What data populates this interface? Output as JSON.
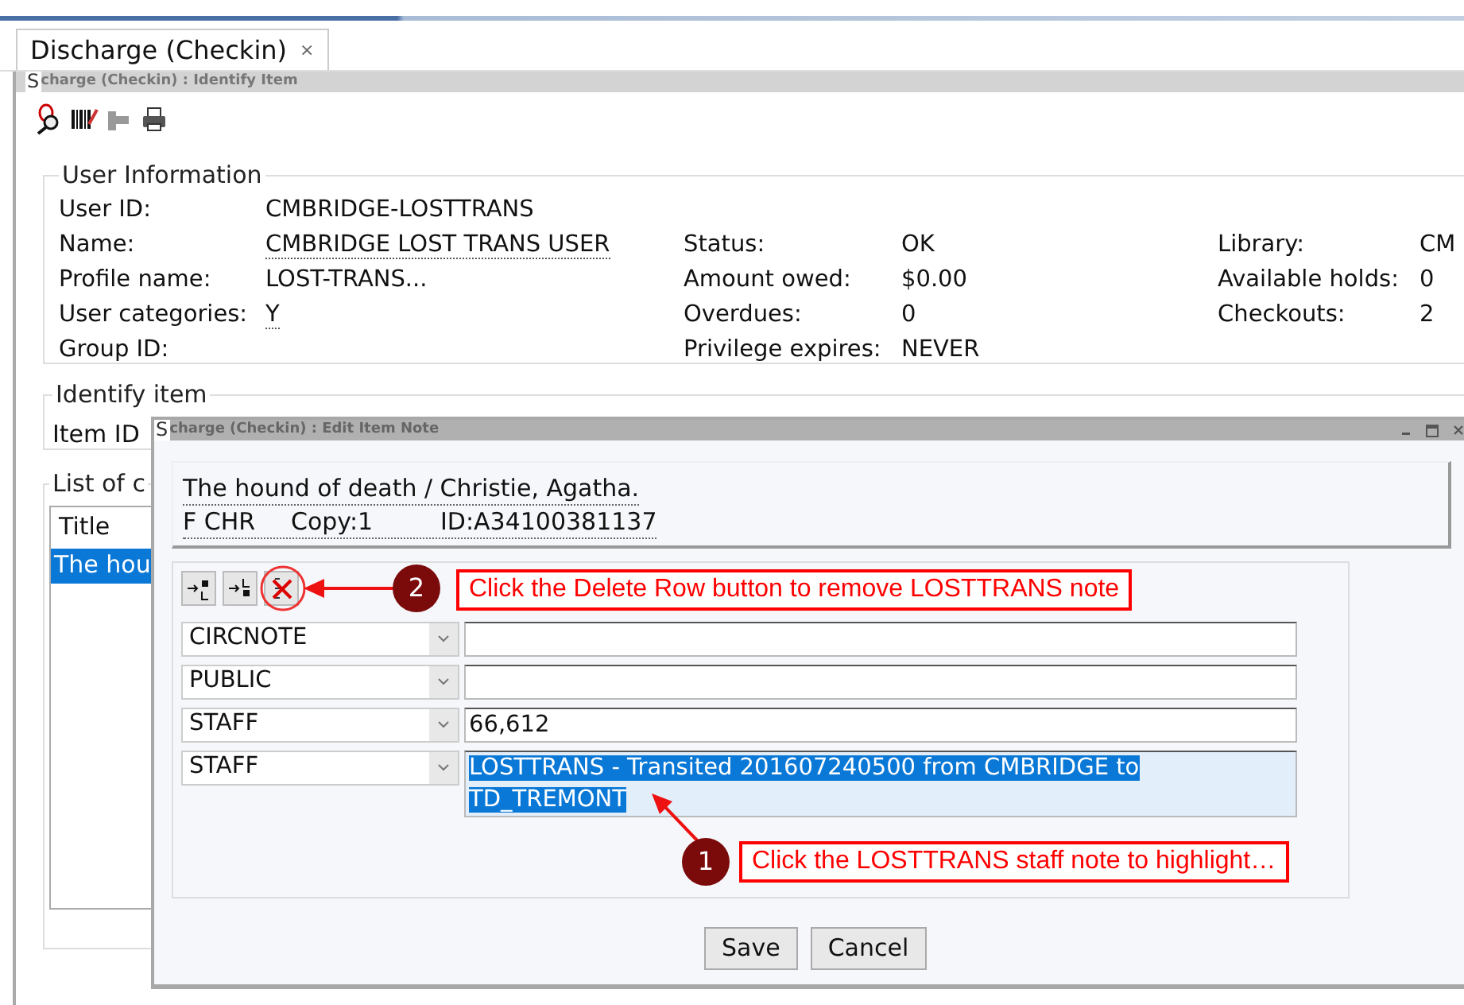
{
  "tab": {
    "label": "Discharge (Checkin)",
    "close": "×",
    "selected": true
  },
  "panel_title": {
    "s_box": "S",
    "text": "charge (Checkin) : Identify Item"
  },
  "user_information": {
    "legend": "User Information",
    "columns": [
      {
        "fields": [
          {
            "label": "User ID:",
            "value": "CMBRIDGE-LOSTTRANS",
            "linked": false
          },
          {
            "label": "Name:",
            "value": "CMBRIDGE LOST TRANS USER",
            "linked": true
          },
          {
            "label": "Profile name:",
            "value": "LOST-TRANS...",
            "linked": false
          },
          {
            "label": "User categories:",
            "value": "Y",
            "linked": true
          },
          {
            "label": "Group ID:"
          }
        ]
      },
      {
        "fields": [
          {
            "label": "Status:",
            "value": "OK",
            "linked": false
          },
          {
            "label": "Amount owed:",
            "value": "$0.00",
            "linked": false
          },
          {
            "label": "Overdues:",
            "value": "0",
            "linked": false
          },
          {
            "label": "Privilege expires:",
            "value": "NEVER",
            "linked": false
          }
        ]
      },
      {
        "fields": [
          {
            "label": "Library:",
            "value": "CM",
            "linked": false
          },
          {
            "label": "Available holds:",
            "value": "0",
            "linked": false
          },
          {
            "label": "Checkouts:",
            "value": "2",
            "linked": false
          }
        ]
      }
    ]
  },
  "identify_item": {
    "legend": "Identify item",
    "label": "Item ID"
  },
  "list": {
    "legend": "List of c",
    "column": "Title",
    "rows": [
      {
        "text": "The hou",
        "selected": true
      }
    ]
  },
  "dialog": {
    "s_box": "S",
    "title": "charge (Checkin) : Edit Item Note",
    "item": {
      "title": "The hound of death / Christie, Agatha.",
      "call_number": "F CHR",
      "copy": "Copy:1",
      "id": "ID:A34100381137"
    },
    "tools": [
      {
        "kind": "insert"
      },
      {
        "kind": "append"
      },
      {
        "kind": "delete"
      }
    ],
    "notes": [
      {
        "type": "CIRCNOTE",
        "selected": false
      },
      {
        "type": "PUBLIC",
        "selected": false
      },
      {
        "type": "STAFF",
        "text": "66,612",
        "selected": false
      },
      {
        "type": "STAFF",
        "text": "LOSTTRANS - Transited 201607240500 from CMBRIDGE to TD_TREMONT",
        "selected": true
      }
    ],
    "buttons": [
      "Save",
      "Cancel"
    ]
  },
  "annotations": [
    {
      "number": "2",
      "text": "Click the Delete Row button to remove LOSTTRANS note"
    },
    {
      "number": "1",
      "text": "Click the LOSTTRANS staff note to highlight…"
    }
  ]
}
